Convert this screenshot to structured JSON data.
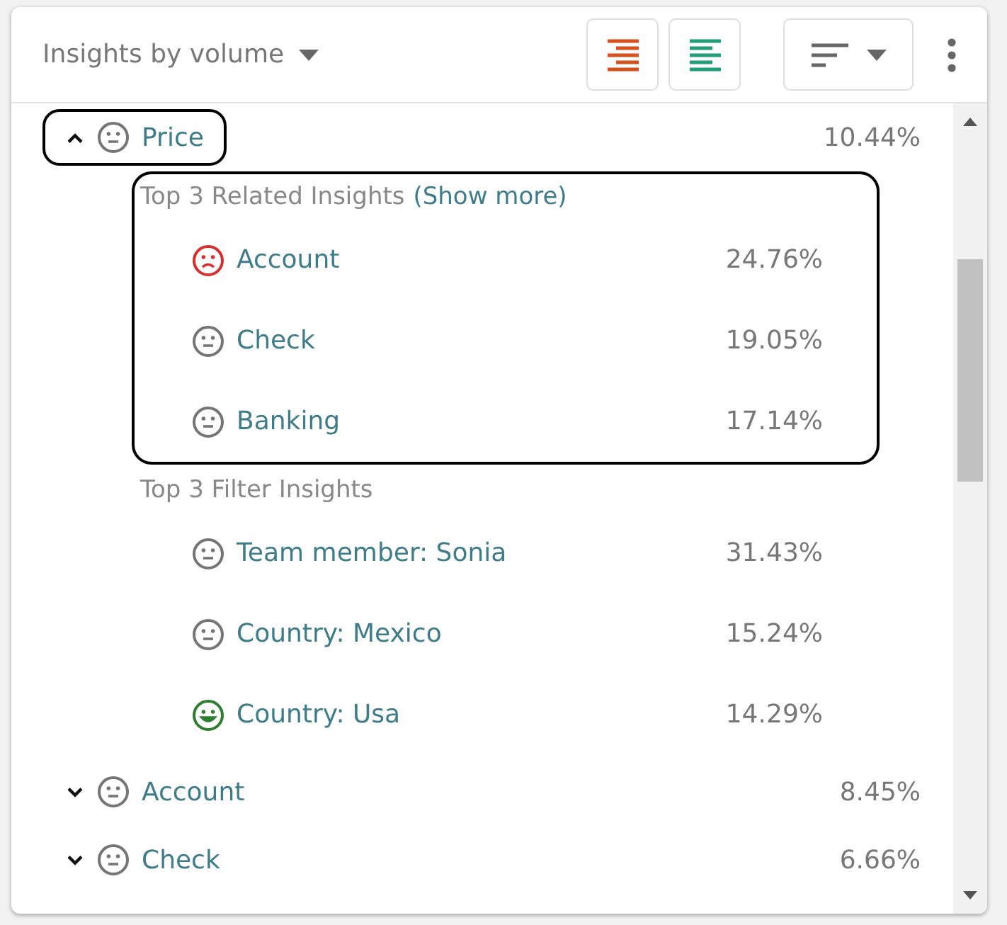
{
  "header": {
    "title": "Insights by volume",
    "view_buttons": [
      {
        "kind": "align-right",
        "color": "#d4531c"
      },
      {
        "kind": "align-left",
        "color": "#1f9e78"
      }
    ]
  },
  "items": [
    {
      "label": "Price",
      "value": "10.44%",
      "kind": "neutral",
      "expanded": true,
      "highlighted": true,
      "groups": [
        {
          "title": "Top 3 Related Insights",
          "link": "(Show more)",
          "highlighted": true,
          "children": [
            {
              "label": "Account",
              "value": "24.76%",
              "kind": "negative"
            },
            {
              "label": "Check",
              "value": "19.05%",
              "kind": "neutral"
            },
            {
              "label": "Banking",
              "value": "17.14%",
              "kind": "neutral"
            }
          ]
        },
        {
          "title": "Top 3 Filter Insights",
          "highlighted": false,
          "children": [
            {
              "label": "Team member: Sonia",
              "value": "31.43%",
              "kind": "neutral"
            },
            {
              "label": "Country: Mexico",
              "value": "15.24%",
              "kind": "neutral"
            },
            {
              "label": "Country: Usa",
              "value": "14.29%",
              "kind": "positive"
            }
          ]
        }
      ]
    },
    {
      "label": "Account",
      "value": "8.45%",
      "kind": "neutral",
      "expanded": false,
      "highlighted": false
    },
    {
      "label": "Check",
      "value": "6.66%",
      "kind": "neutral",
      "expanded": false,
      "highlighted": false
    }
  ]
}
